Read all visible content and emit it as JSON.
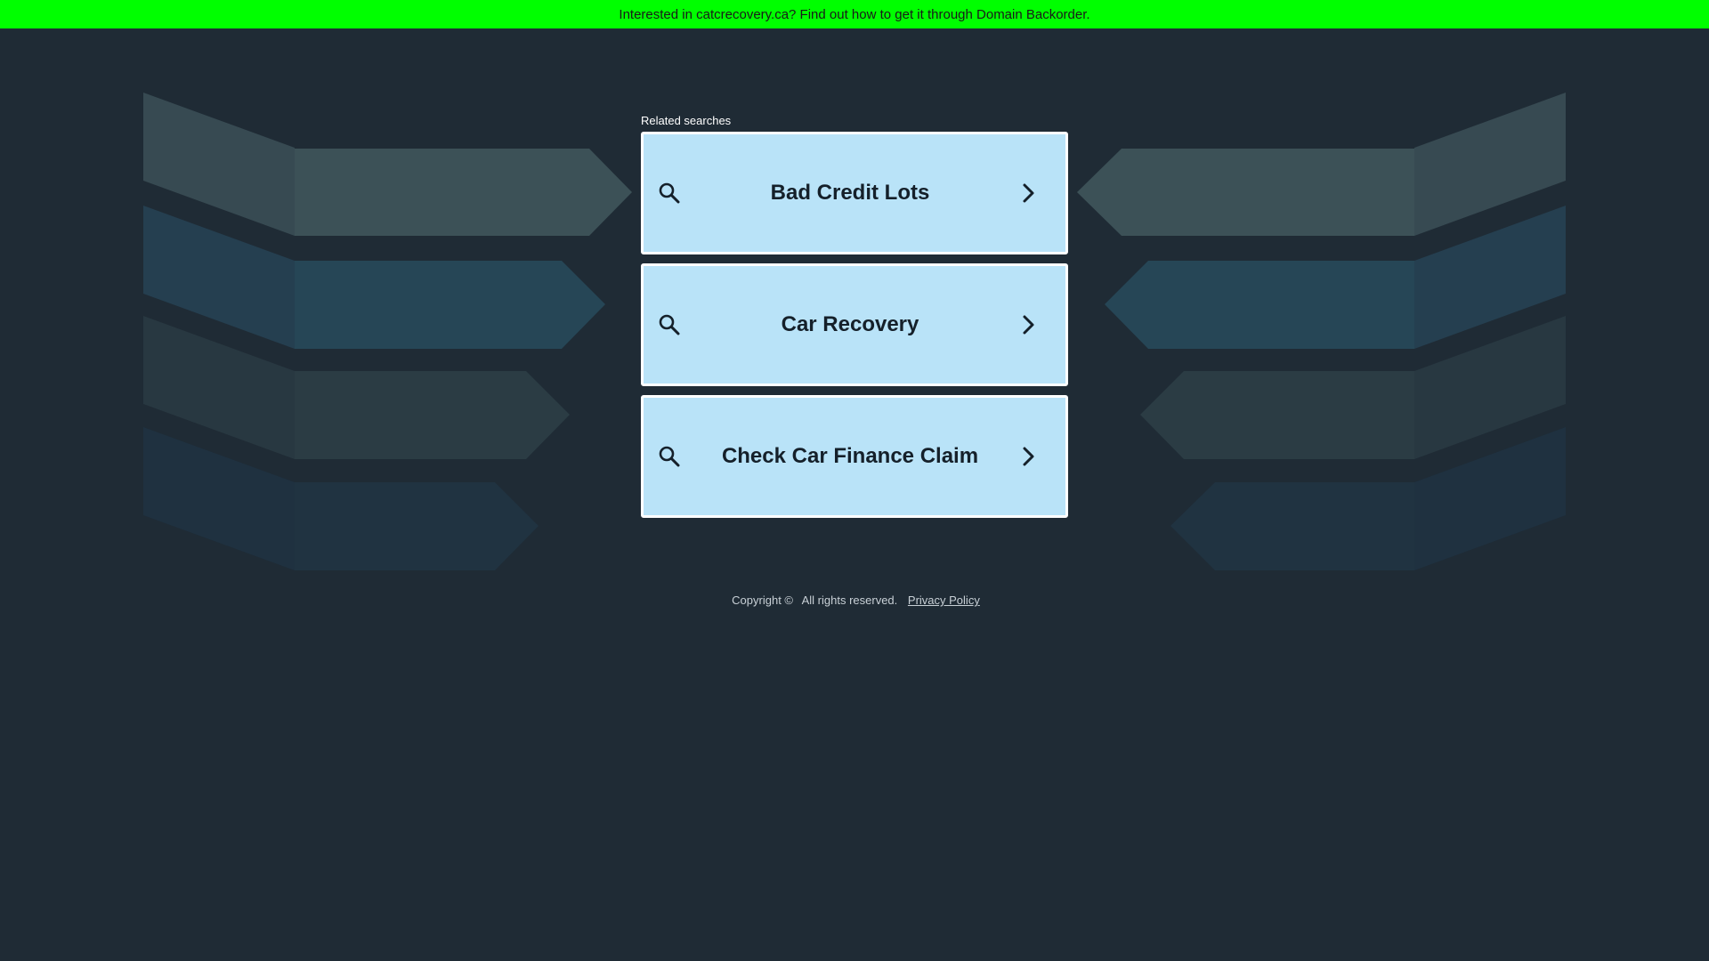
{
  "banner": {
    "text": "Interested in catcrecovery.ca? Find out how to get it through Domain Backorder."
  },
  "related": {
    "heading": "Related searches",
    "items": [
      {
        "label": "Bad Credit Lots",
        "icon": "search-icon",
        "chevron": "chevron-right-icon"
      },
      {
        "label": "Car Recovery",
        "icon": "search-icon",
        "chevron": "chevron-right-icon"
      },
      {
        "label": "Check Car Finance Claim",
        "icon": "search-icon",
        "chevron": "chevron-right-icon"
      }
    ]
  },
  "footer": {
    "copyright": "Copyright ©",
    "rights": "All rights reserved.",
    "privacy_link": "Privacy Policy"
  },
  "colors": {
    "background": "#1f2b35",
    "banner": "#00ff00",
    "card_fill": "#b9e3f8",
    "card_border": "#ffffff",
    "text_dark": "#15202a"
  }
}
